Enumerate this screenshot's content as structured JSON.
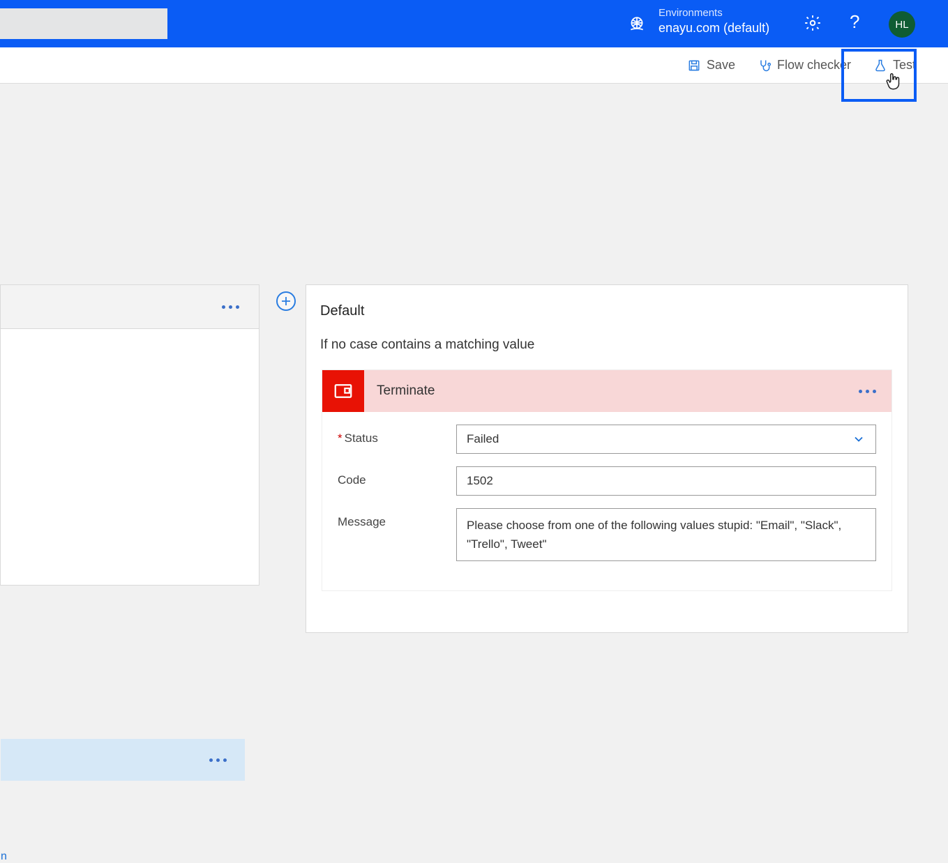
{
  "header": {
    "env_label": "Environments",
    "env_name": "enayu.com (default)",
    "avatar_initials": "HL"
  },
  "toolbar": {
    "save_label": "Save",
    "checker_label": "Flow checker",
    "test_label": "Test"
  },
  "left_panel": {
    "link_text_fragment": "n"
  },
  "default_card": {
    "title": "Default",
    "subtitle": "If no case contains a matching value"
  },
  "terminate": {
    "title": "Terminate",
    "fields": {
      "status_label": "Status",
      "status_value": "Failed",
      "code_label": "Code",
      "code_value": "1502",
      "message_label": "Message",
      "message_value": "Please choose from one of the following values stupid: \"Email\", \"Slack\", \"Trello\", Tweet\""
    }
  }
}
